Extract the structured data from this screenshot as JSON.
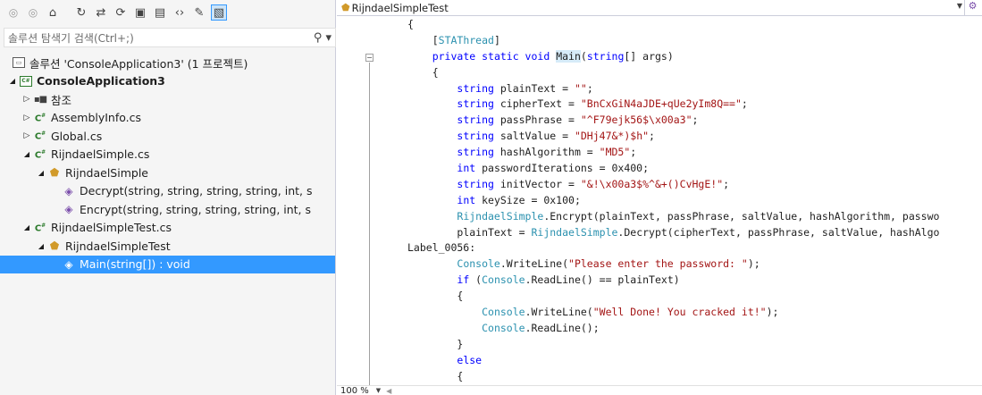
{
  "solution_explorer": {
    "toolbar_icons": [
      "back-icon",
      "forward-icon",
      "home-icon",
      "history-icon",
      "sync-icon",
      "refresh-icon",
      "collapse-all-icon",
      "show-all-files-icon",
      "view-code-icon",
      "properties-icon",
      "preview-icon"
    ],
    "search_placeholder": "솔루션 탐색기 검색(Ctrl+;)",
    "tree": [
      {
        "label": "솔루션 'ConsoleApplication3' (1 프로젝트)",
        "level": 0,
        "icon": "solution-icon",
        "expander": ""
      },
      {
        "label": "ConsoleApplication3",
        "level": 0,
        "icon": "csharp-project-icon",
        "expander": "open",
        "bold": true
      },
      {
        "label": "참조",
        "level": 1,
        "icon": "references-icon",
        "expander": "closed"
      },
      {
        "label": "AssemblyInfo.cs",
        "level": 1,
        "icon": "csharp-file-icon",
        "expander": "closed"
      },
      {
        "label": "Global.cs",
        "level": 1,
        "icon": "csharp-file-icon",
        "expander": "closed"
      },
      {
        "label": "RijndaelSimple.cs",
        "level": 1,
        "icon": "csharp-file-icon",
        "expander": "open"
      },
      {
        "label": "RijndaelSimple",
        "level": 2,
        "icon": "class-icon",
        "expander": "open"
      },
      {
        "label": "Decrypt(string, string, string, string, int, s",
        "level": 3,
        "icon": "method-icon",
        "expander": ""
      },
      {
        "label": "Encrypt(string, string, string, string, int, s",
        "level": 3,
        "icon": "method-icon",
        "expander": ""
      },
      {
        "label": "RijndaelSimpleTest.cs",
        "level": 1,
        "icon": "csharp-file-icon",
        "expander": "open"
      },
      {
        "label": "RijndaelSimpleTest",
        "level": 2,
        "icon": "class-icon",
        "expander": "open"
      },
      {
        "label": "Main(string[]) : void",
        "level": 3,
        "icon": "method-icon",
        "expander": "",
        "selected": true
      }
    ]
  },
  "editor": {
    "class_dropdown": "RijndaelSimpleTest",
    "zoom": "100 %",
    "code_lines": [
      [
        [
          "{",
          "plain"
        ]
      ],
      [
        [
          "    ",
          "plain"
        ],
        [
          "[",
          "plain"
        ],
        [
          "STAThread",
          "attr"
        ],
        [
          "]",
          "plain"
        ]
      ],
      [
        [
          "    ",
          "plain"
        ],
        [
          "private static void ",
          "kw"
        ],
        [
          "Main",
          "hl"
        ],
        [
          "(",
          "plain"
        ],
        [
          "string",
          "kw"
        ],
        [
          "[] args)",
          "plain"
        ]
      ],
      [
        [
          "    {",
          "plain"
        ]
      ],
      [
        [
          "        ",
          "plain"
        ],
        [
          "string",
          "kw"
        ],
        [
          " plainText = ",
          "plain"
        ],
        [
          "\"\"",
          "str"
        ],
        [
          ";",
          "plain"
        ]
      ],
      [
        [
          "        ",
          "plain"
        ],
        [
          "string",
          "kw"
        ],
        [
          " cipherText = ",
          "plain"
        ],
        [
          "\"BnCxGiN4aJDE+qUe2yIm8Q==\"",
          "str"
        ],
        [
          ";",
          "plain"
        ]
      ],
      [
        [
          "        ",
          "plain"
        ],
        [
          "string",
          "kw"
        ],
        [
          " passPhrase = ",
          "plain"
        ],
        [
          "\"^F79ejk56$\\x00a3\"",
          "str"
        ],
        [
          ";",
          "plain"
        ]
      ],
      [
        [
          "        ",
          "plain"
        ],
        [
          "string",
          "kw"
        ],
        [
          " saltValue = ",
          "plain"
        ],
        [
          "\"DHj47&*)$h\"",
          "str"
        ],
        [
          ";",
          "plain"
        ]
      ],
      [
        [
          "        ",
          "plain"
        ],
        [
          "string",
          "kw"
        ],
        [
          " hashAlgorithm = ",
          "plain"
        ],
        [
          "\"MD5\"",
          "str"
        ],
        [
          ";",
          "plain"
        ]
      ],
      [
        [
          "        ",
          "plain"
        ],
        [
          "int",
          "kw"
        ],
        [
          " passwordIterations = 0x400;",
          "plain"
        ]
      ],
      [
        [
          "        ",
          "plain"
        ],
        [
          "string",
          "kw"
        ],
        [
          " initVector = ",
          "plain"
        ],
        [
          "\"&!\\x00a3$%^&+()CvHgE!\"",
          "str"
        ],
        [
          ";",
          "plain"
        ]
      ],
      [
        [
          "        ",
          "plain"
        ],
        [
          "int",
          "kw"
        ],
        [
          " keySize = 0x100;",
          "plain"
        ]
      ],
      [
        [
          "        ",
          "plain"
        ],
        [
          "RijndaelSimple",
          "type"
        ],
        [
          ".Encrypt(plainText, passPhrase, saltValue, hashAlgorithm, passwo",
          "plain"
        ]
      ],
      [
        [
          "        plainText = ",
          "plain"
        ],
        [
          "RijndaelSimple",
          "type"
        ],
        [
          ".Decrypt(cipherText, passPhrase, saltValue, hashAlgo",
          "plain"
        ]
      ],
      [
        [
          "Label_0056:",
          "plain"
        ]
      ],
      [
        [
          "        ",
          "plain"
        ],
        [
          "Console",
          "type"
        ],
        [
          ".WriteLine(",
          "plain"
        ],
        [
          "\"Please enter the password: \"",
          "str"
        ],
        [
          ");",
          "plain"
        ]
      ],
      [
        [
          "        ",
          "plain"
        ],
        [
          "if",
          "kw"
        ],
        [
          " (",
          "plain"
        ],
        [
          "Console",
          "type"
        ],
        [
          ".ReadLine() == plainText)",
          "plain"
        ]
      ],
      [
        [
          "        {",
          "plain"
        ]
      ],
      [
        [
          "            ",
          "plain"
        ],
        [
          "Console",
          "type"
        ],
        [
          ".WriteLine(",
          "plain"
        ],
        [
          "\"Well Done! You cracked it!\"",
          "str"
        ],
        [
          ");",
          "plain"
        ]
      ],
      [
        [
          "            ",
          "plain"
        ],
        [
          "Console",
          "type"
        ],
        [
          ".ReadLine();",
          "plain"
        ]
      ],
      [
        [
          "        }",
          "plain"
        ]
      ],
      [
        [
          "        ",
          "plain"
        ],
        [
          "else",
          "kw"
        ]
      ],
      [
        [
          "        {",
          "plain"
        ]
      ]
    ]
  }
}
